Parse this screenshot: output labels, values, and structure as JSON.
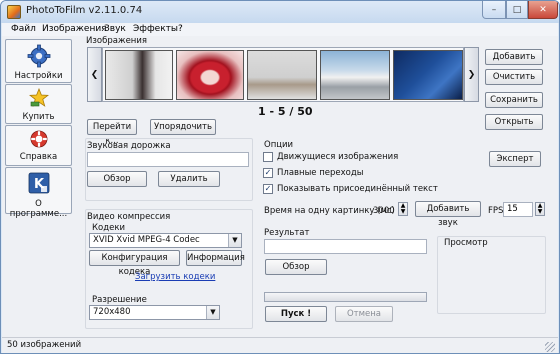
{
  "window": {
    "title": "PhotoToFilm v2.11.0.74"
  },
  "menu": {
    "items": [
      "Файл",
      "Изображения",
      "Звук",
      "Эффекты",
      "?"
    ]
  },
  "sidebar": {
    "items": [
      {
        "label": "Настройки",
        "icon": "gear-icon"
      },
      {
        "label": "Купить",
        "icon": "buy-star-icon"
      },
      {
        "label": "Справка",
        "icon": "help-icon"
      },
      {
        "label": "О программе...",
        "icon": "about-k-icon"
      }
    ]
  },
  "images": {
    "group_title": "Изображения",
    "counter": "1 - 5 / 50",
    "goto_label": "Перейти к...",
    "sort_label": "Упорядочить",
    "thumbnails": [
      "woman-portrait",
      "lips-closeup",
      "dancer-on-stage",
      "sports-car",
      "blue-brand-graphic"
    ]
  },
  "right_buttons": {
    "add": "Добавить",
    "clear": "Очистить",
    "save": "Сохранить",
    "open": "Открыть"
  },
  "audio": {
    "group_title": "Звуковая дорожка",
    "file_value": "",
    "browse_label": "Обзор",
    "delete_label": "Удалить"
  },
  "video": {
    "group_title": "Видео компрессия",
    "codecs_label": "Кодеки",
    "codec_selected": "XVID Xvid MPEG-4 Codec",
    "config_label": "Конфигурация кодека",
    "info_label": "Информация",
    "download_link": "Загрузить кодеки",
    "resolution_label": "Разрешение",
    "resolution_selected": "720x480"
  },
  "options": {
    "group_title": "Опции",
    "moving_images": {
      "label": "Движущиеся изображения",
      "checked": false
    },
    "smooth_transitions": {
      "label": "Плавные переходы",
      "checked": true
    },
    "show_text": {
      "label": "Показывать присоединённый текст",
      "checked": true
    },
    "expert_label": "Эксперт",
    "time_label": "Время на одну картинку (мс) :",
    "time_value": "3000",
    "add_sound_label": "Добавить звук",
    "fps_label": "FPS",
    "fps_value": "15"
  },
  "result": {
    "group_title": "Результат",
    "file_value": "",
    "browse_label": "Обзор",
    "preview_label": "Просмотр",
    "start_label": "Пуск !",
    "cancel_label": "Отмена"
  },
  "status": {
    "text": "50 изображений"
  }
}
